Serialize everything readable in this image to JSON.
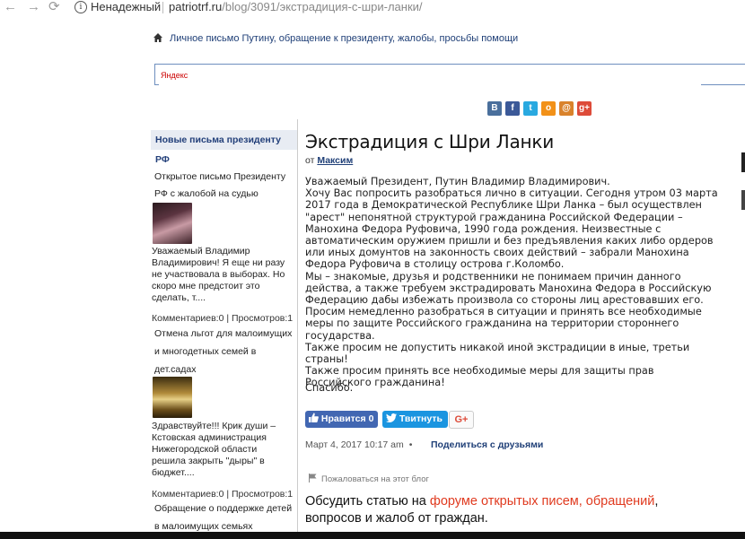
{
  "browser": {
    "back_icon": "←",
    "forward_icon": "→",
    "reload_icon": "⟳",
    "info_icon": "i",
    "security_label": "Ненадежный",
    "url_domain": "patriotrf.ru",
    "url_path": "/blog/3091/экстрадиция-с-шри-ланки/"
  },
  "header": {
    "breadcrumb": "Личное письмо Путину, обращение к президенту, жалобы, просьбы помощи",
    "search_value": "Яндекс"
  },
  "share_icons": [
    {
      "name": "vk-share-icon",
      "glyph": "B",
      "color": "#4a6f9c"
    },
    {
      "name": "facebook-share-icon",
      "glyph": "f",
      "color": "#3b5998"
    },
    {
      "name": "twitter-share-icon",
      "glyph": "t",
      "color": "#29a9e0"
    },
    {
      "name": "odnoklassniki-share-icon",
      "glyph": "o",
      "color": "#f29118"
    },
    {
      "name": "moimir-share-icon",
      "glyph": "@",
      "color": "#d9822b"
    },
    {
      "name": "googleplus-share-icon",
      "glyph": "g+",
      "color": "#dd4b39"
    }
  ],
  "sidebar": {
    "heading": "Новые письма президенту РФ",
    "post1_title_1": "Открытое письмо Президенту",
    "post1_title_2": "РФ с жалобой на судью",
    "post2_excerpt": "Уважаемый Владимир Владимирович! Я еще ни разу не участвовала в выборах. Но скоро мне предстоит это сделать, т....",
    "post2_meta": "Комментариев:0 | Просмотров:1",
    "post3_title_1": "Отмена льгот для малоимущих",
    "post3_title_2": "и многодетных семей в",
    "post3_title_3": "дет.садах",
    "post4_excerpt": "Здравствуйте!!! Крик души – Кстовская администрация Нижегородской области решила закрыть \"дыры\" в бюджет....",
    "post4_meta": "Комментариев:0 | Просмотров:1",
    "post5_title_1": "Обращение о поддержке детей",
    "post5_title_2": "в малоимущих семьях"
  },
  "article": {
    "title": "Экстрадиция с Шри Ланки",
    "by_prefix": "от",
    "author": "Максим",
    "paragraphs": [
      "Уважаемый Президент, Путин Владимир Владимирович.",
      "Хочу Вас попросить разобраться лично в ситуации. Сегодня утром 03 марта 2017 года в Демократической Республике Шри Ланка – был осуществлен \"арест\" непонятной структурой гражданина Российской Федерации – Манохина Федора Руфовича, 1990 года рождения. Неизвестные с автоматическим оружием пришли и без предъявления каких либо ордеров или иных домунтов на законность своих действий – забрали Манохина Федора Руфовича в столицу острова г.Коломбо.",
      "Мы – знакомые, друзья и родственники не понимаем причин данного действа, а также требуем экстрадировать Манохина Федора в Российскую Федерацию дабы избежать произвола со стороны лиц арестовавших его.",
      "Просим немедленно разобраться в ситуации и принять все необходимые меры по защите Российского гражданина на территории стороннего государства.",
      "Также просим не допустить никакой иной экстрадиции в иные, третьи страны!",
      "Также просим принять все необходимые меры для защиты прав Российского гражданина!"
    ],
    "thanks": "Спасибо.",
    "fb_label": "Нравится",
    "fb_count": "0",
    "tw_label": "Твитнуть",
    "gplus_label": "G+",
    "date": "Март 4, 2017 10:17 am",
    "date_sep": "•",
    "share_friends": "Поделиться с друзьями",
    "complain": "Пожаловаться на этот блог",
    "discuss_prefix": "Обсудить статью на ",
    "discuss_link": "форуме открытых писем, обращений",
    "discuss_suffix": ", вопросов и жалоб от граждан."
  },
  "colors": {
    "link_blue": "#1f3f77",
    "accent_red": "#e03a1f",
    "facebook_blue": "#4267b2",
    "twitter_blue": "#1b95e0"
  }
}
